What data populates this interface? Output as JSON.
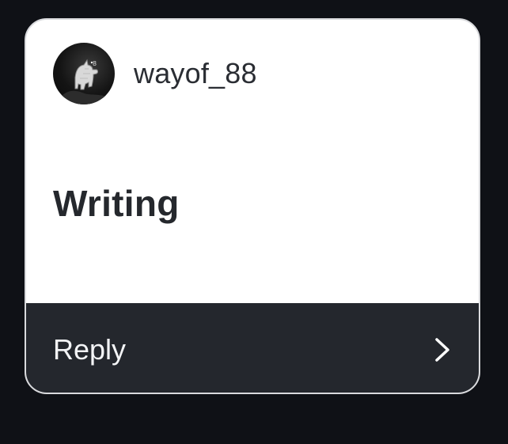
{
  "post": {
    "author": {
      "username": "wayof_88",
      "avatar_icon": "wolf-avatar-icon",
      "avatar_badge": "8"
    },
    "title": "Writing"
  },
  "footer": {
    "reply_label": "Reply",
    "chevron_icon": "chevron-right-icon"
  },
  "colors": {
    "background": "#0f1116",
    "card_background": "#ffffff",
    "card_border": "#d9dadd",
    "footer_background": "#24272d",
    "text_dark": "#25282d",
    "text_light": "#f3f4f6"
  }
}
